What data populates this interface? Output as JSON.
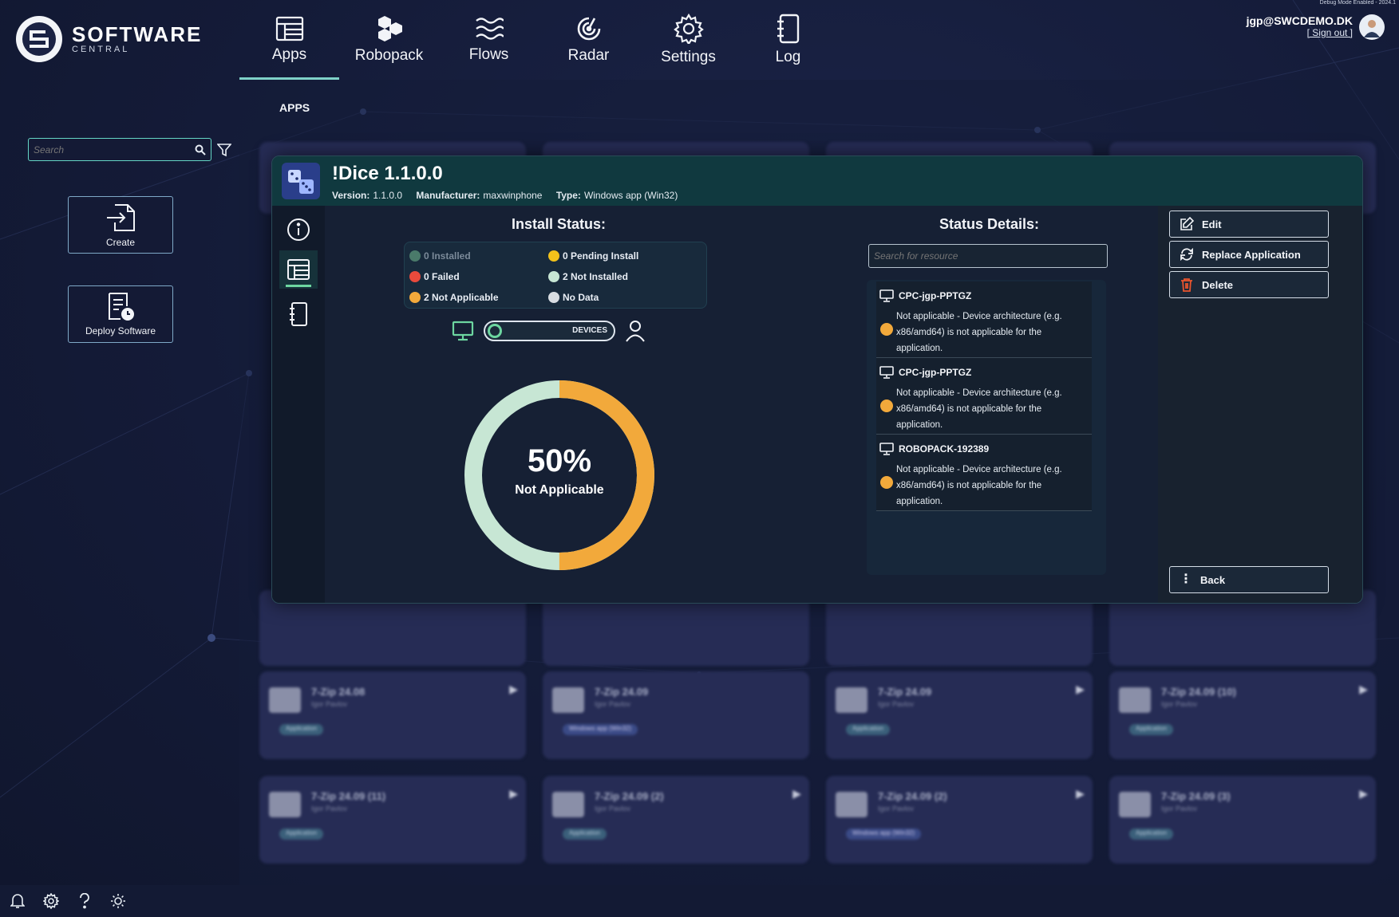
{
  "debug_text": "Debug Mode Enabled - 2024.1",
  "logo": {
    "title": "SOFTWARE",
    "subtitle": "CENTRAL"
  },
  "nav": [
    {
      "label": "Apps",
      "icon": "apps-icon",
      "active": true
    },
    {
      "label": "Robopack",
      "icon": "robopack-icon"
    },
    {
      "label": "Flows",
      "icon": "flows-icon"
    },
    {
      "label": "Radar",
      "icon": "radar-icon"
    },
    {
      "label": "Settings",
      "icon": "settings-icon"
    },
    {
      "label": "Log",
      "icon": "log-icon"
    }
  ],
  "user": {
    "email": "jgp@SWCDEMO.DK",
    "signout": "[ Sign out ]"
  },
  "sidebar": {
    "search_placeholder": "Search",
    "create_label": "Create",
    "deploy_label": "Deploy Software"
  },
  "main": {
    "section_label": "APPS"
  },
  "tiles": [
    {
      "name": "7-Zip 24.08",
      "sub": "Igor Pavlov",
      "badge": "Application",
      "win": false
    },
    {
      "name": "7-Zip 24.09",
      "sub": "Igor Pavlov",
      "badge": "Windows app (Win32)",
      "win": true
    },
    {
      "name": "7-Zip 24.09",
      "sub": "Igor Pavlov",
      "badge": "Application",
      "win": false
    },
    {
      "name": "7-Zip 24.09 (10)",
      "sub": "Igor Pavlov",
      "badge": "Application",
      "win": false
    },
    {
      "name": "7-Zip 24.09 (11)",
      "sub": "Igor Pavlov",
      "badge": "Application",
      "win": false
    },
    {
      "name": "7-Zip 24.09 (2)",
      "sub": "Igor Pavlov",
      "badge": "Application",
      "win": false
    },
    {
      "name": "7-Zip 24.09 (2)",
      "sub": "Igor Pavlov",
      "badge": "Windows app (Win32)",
      "win": true
    },
    {
      "name": "7-Zip 24.09 (3)",
      "sub": "Igor Pavlov",
      "badge": "Application",
      "win": false
    }
  ],
  "modal": {
    "title": "!Dice 1.1.0.0",
    "version_label": "Version:",
    "version": "1.1.0.0",
    "manufacturer_label": "Manufacturer:",
    "manufacturer": "maxwinphone",
    "type_label": "Type:",
    "type": "Windows app (Win32)",
    "install_status_title": "Install Status:",
    "status_details_title": "Status Details:",
    "legend": [
      {
        "label": "0 Installed",
        "color": "#4a7a6a",
        "dim": true
      },
      {
        "label": "0 Pending Install",
        "color": "#f2c21b"
      },
      {
        "label": "0 Failed",
        "color": "#e84a3c"
      },
      {
        "label": "2 Not Installed",
        "color": "#c7e6d4"
      },
      {
        "label": "2 Not Applicable",
        "color": "#f2a93b"
      },
      {
        "label": "No Data",
        "color": "#d8dde2"
      }
    ],
    "toggle_label": "DEVICES",
    "donut": {
      "percent": "50%",
      "label": "Not Applicable",
      "orange_fraction": 0.5,
      "orange_color": "#f2a93b",
      "light_color": "#c7e6d4"
    },
    "resource_search_placeholder": "Search for resource",
    "resources": [
      {
        "name": "CPC-jgp-PPTGZ",
        "message": "Not applicable - Device architecture (e.g. x86/amd64) is not applicable for the application."
      },
      {
        "name": "CPC-jgp-PPTGZ",
        "message": "Not applicable - Device architecture (e.g. x86/amd64) is not applicable for the application."
      },
      {
        "name": "ROBOPACK-192389",
        "message": "Not applicable - Device architecture (e.g. x86/amd64) is not applicable for the application."
      }
    ],
    "actions": {
      "edit": "Edit",
      "replace": "Replace Application",
      "delete": "Delete",
      "back": "Back"
    }
  }
}
